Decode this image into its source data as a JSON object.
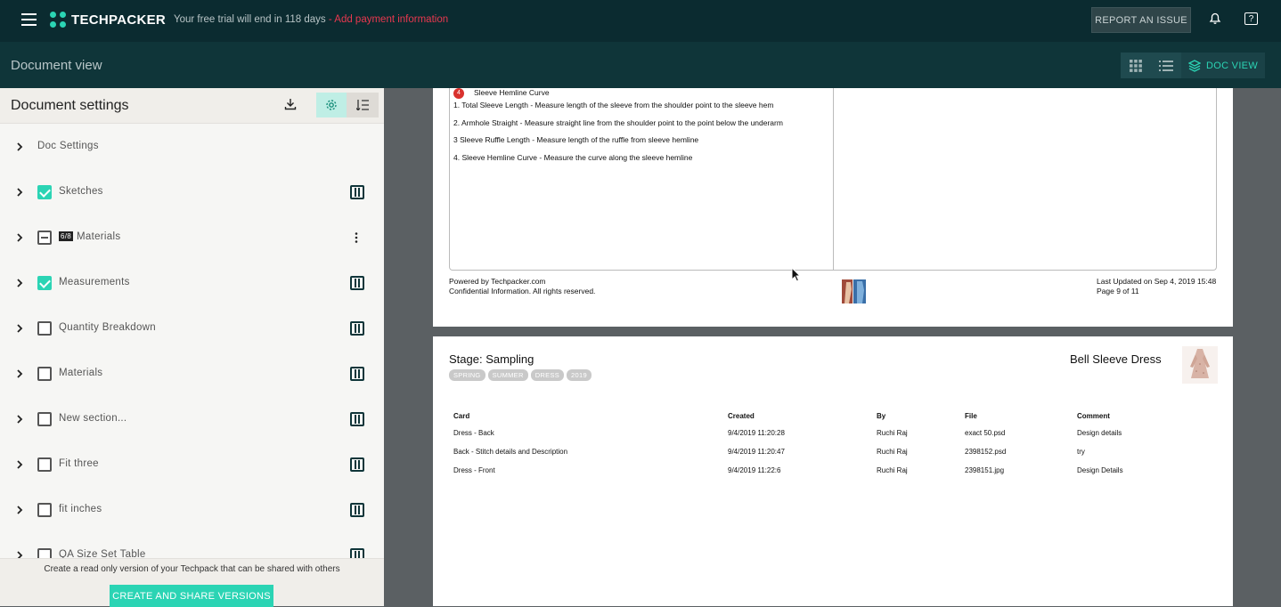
{
  "topbar": {
    "brand": "TECHPACKER",
    "trial_text": "Your free trial will end in 118 days",
    "trial_link": " - Add payment information",
    "report_label": "REPORT AN ISSUE"
  },
  "subbar": {
    "title": "Document view",
    "doc_view_label": "DOC VIEW"
  },
  "sidebar": {
    "title": "Document settings",
    "items": [
      {
        "label": "Doc Settings",
        "checkbox": "none",
        "action": "none"
      },
      {
        "label": "Sketches",
        "checkbox": "checked",
        "action": "columns"
      },
      {
        "label": "Materials",
        "badge": "6/8",
        "checkbox": "indeterminate",
        "action": "menu"
      },
      {
        "label": "Measurements",
        "checkbox": "checked",
        "action": "columns"
      },
      {
        "label": "Quantity Breakdown",
        "checkbox": "unchecked",
        "action": "columns"
      },
      {
        "label": "Materials",
        "checkbox": "unchecked",
        "action": "columns"
      },
      {
        "label": "New section...",
        "checkbox": "unchecked",
        "action": "columns"
      },
      {
        "label": "Fit three",
        "checkbox": "unchecked",
        "action": "columns"
      },
      {
        "label": "fit inches",
        "checkbox": "unchecked",
        "action": "columns"
      },
      {
        "label": "QA Size Set Table",
        "checkbox": "unchecked",
        "action": "columns"
      }
    ],
    "footer_text": "Create a read only version of your Techpack that can be shared with others",
    "share_label": "CREATE AND SHARE VERSIONS"
  },
  "doc1": {
    "marker_number": "4",
    "marker_title": "Sleeve Hemline Curve",
    "notes": [
      "1. Total Sleeve Length - Measure length of the sleeve from the shoulder point to the sleeve hem",
      "2. Armhole Straight - Measure straight line from the shoulder point to the point below the underarm",
      "3 Sleeve Ruffle Length - Measure length of the ruffle from sleeve hemline",
      "4. Sleeve Hemline Curve - Measure the curve along the sleeve hemline"
    ],
    "footer_left_1": "Powered by Techpacker.com",
    "footer_left_2": "Confidential Information. All rights reserved.",
    "footer_right_1": "Last Updated on Sep 4, 2019 15:48",
    "footer_right_2": "Page 9 of 11"
  },
  "doc2": {
    "stage": "Stage: Sampling",
    "tags": [
      "SPRING",
      "SUMMER",
      "DRESS",
      "2019"
    ],
    "product_name": "Bell Sleeve Dress",
    "table": {
      "headers": [
        "Card",
        "Created",
        "By",
        "File",
        "Comment"
      ],
      "rows": [
        [
          "Dress - Back",
          "9/4/2019 11:20:28",
          "Ruchi Raj",
          "exact 50.psd",
          "Design details"
        ],
        [
          "Back - Stitch details and Description",
          "9/4/2019 11:20:47",
          "Ruchi Raj",
          "2398152.psd",
          "try"
        ],
        [
          "Dress - Front",
          "9/4/2019 11:22:6",
          "Ruchi Raj",
          "2398151.jpg",
          "Design Details"
        ]
      ]
    }
  },
  "colors": {
    "accent": "#2bd4b4",
    "topbar": "#0b2b30",
    "subbar": "#0f3539",
    "link": "#e8384f"
  }
}
